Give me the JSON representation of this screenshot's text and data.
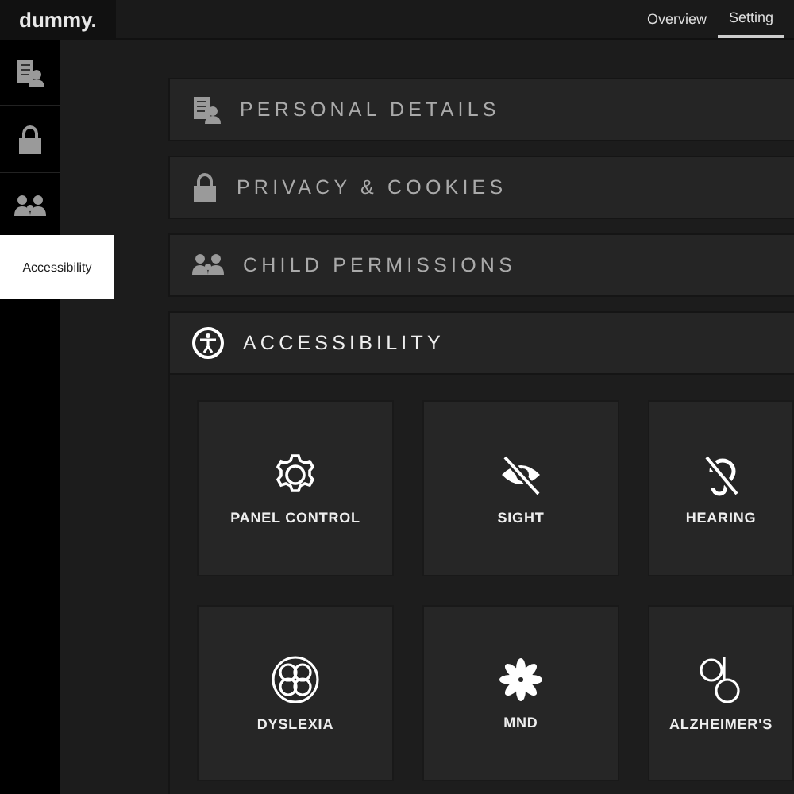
{
  "logo": "dummy.",
  "nav": [
    {
      "label": "Overview",
      "selected": false
    },
    {
      "label": "Setting",
      "selected": true
    }
  ],
  "sidebar": {
    "tooltip": "Accessibility"
  },
  "sections": [
    {
      "title": "PERSONAL DETAILS",
      "expanded": false
    },
    {
      "title": "PRIVACY & COOKIES",
      "expanded": false
    },
    {
      "title": "CHILD PERMISSIONS",
      "expanded": false
    },
    {
      "title": "ACCESSIBILITY",
      "expanded": true,
      "tiles": [
        "PANEL CONTROL",
        "SIGHT",
        "HEARING",
        "DYSLEXIA",
        "MND",
        "ALZHEIMER'S"
      ]
    }
  ]
}
